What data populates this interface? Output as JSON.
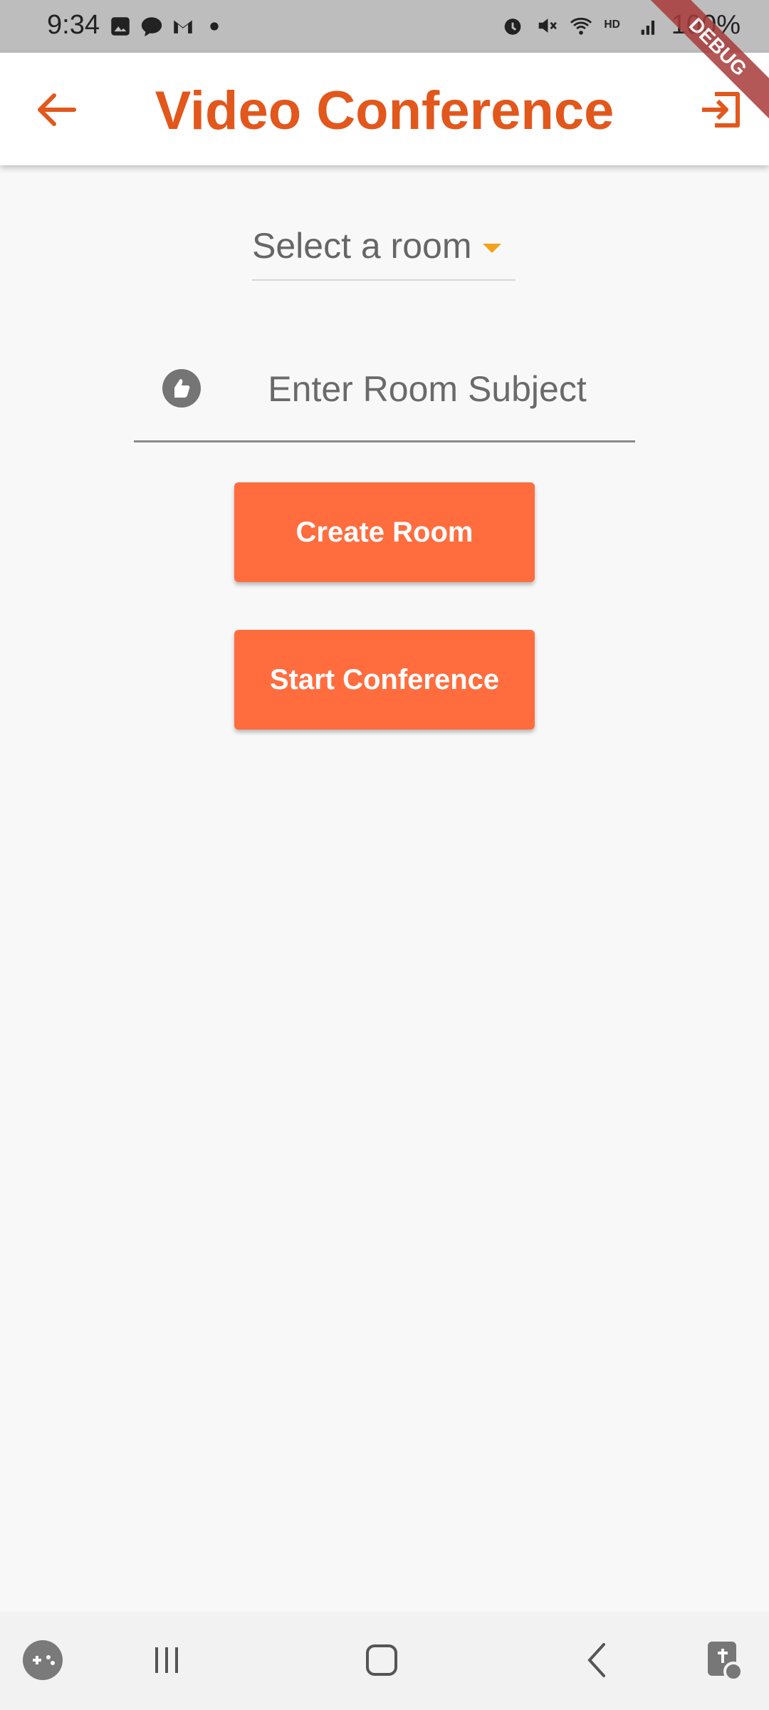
{
  "status_bar": {
    "time": "9:34",
    "battery": "100%",
    "debug_label": "DEBUG"
  },
  "app_bar": {
    "title": "Video Conference",
    "title_color": "#e2571c"
  },
  "room_select": {
    "selected_value": "Select a room"
  },
  "subject_field": {
    "placeholder": "Enter Room Subject"
  },
  "buttons": {
    "create_room": "Create Room",
    "start_conference": "Start Conference",
    "button_color": "#ff6d3f"
  },
  "icons": {
    "back": "arrow-back-icon",
    "exit": "exit-to-app-icon",
    "subject": "thumb-up-icon",
    "dropdown": "dropdown-arrow-icon",
    "nav_game": "game-launcher-icon",
    "nav_recents": "recents-icon",
    "nav_home": "home-icon",
    "nav_back": "nav-back-icon",
    "nav_accessibility": "accessibility-icon"
  }
}
